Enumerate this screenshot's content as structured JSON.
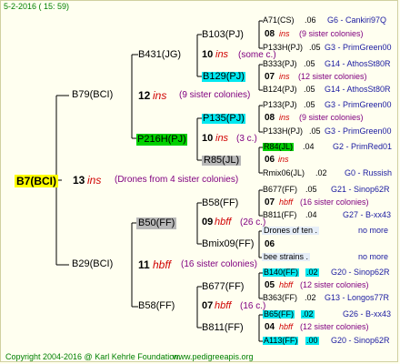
{
  "header": {
    "date": "5-2-2016 ( 15: 59)"
  },
  "footer": {
    "copyright": "Copyright 2004-2016 @ Karl Kehrle Foundation.",
    "site": "www.pedigreeapis.org"
  },
  "root": {
    "id": "B7(BCI)",
    "num": "13",
    "ins": "ins",
    "note": "(Drones from 4 sister colonies)"
  },
  "g1": [
    {
      "id": "B79(BCI)",
      "num": "12",
      "ins": "ins",
      "note": "(9 sister colonies)"
    },
    {
      "id": "B29(BCI)",
      "num": "11",
      "ins": "hbff",
      "note": "(16 sister colonies)"
    }
  ],
  "g2": [
    {
      "id": "B431(JG)",
      "num": "10",
      "ins": "ins",
      "note": "(some c.)"
    },
    {
      "id": "P216H(PJ)",
      "num": "10",
      "ins": "ins",
      "note": "(3 c.)"
    },
    {
      "id": "B50(FF)",
      "num": "09",
      "ins": "hbff",
      "note": "(26 c.)"
    },
    {
      "id": "B58(FF)",
      "num": "07",
      "ins": "hbff",
      "note": "(16 c.)"
    }
  ],
  "g3": [
    "B103(PJ)",
    "B129(PJ)",
    "P135(PJ)",
    "R85(JL)",
    "B58(FF)",
    "Bmix09(FF)",
    "B677(FF)",
    "B811(FF)"
  ],
  "g4": [
    {
      "id": "A71(CS)",
      "num": ".06",
      "ref": "G6 - Cankiri97Q"
    },
    {
      "num": "08",
      "ins": "ins",
      "note": "(9 sister colonies)"
    },
    {
      "id": "P133H(PJ)",
      "num": ".05",
      "ref": "G3 - PrimGreen00"
    },
    {
      "id": "B333(PJ)",
      "num": ".05",
      "ref": "G14 - AthosSt80R"
    },
    {
      "num": "07",
      "ins": "ins",
      "note": "(12 sister colonies)"
    },
    {
      "id": "B124(PJ)",
      "num": ".05",
      "ref": "G14 - AthosSt80R"
    },
    {
      "id": "P133(PJ)",
      "num": ".05",
      "ref": "G3 - PrimGreen00"
    },
    {
      "num": "08",
      "ins": "ins",
      "note": "(9 sister colonies)"
    },
    {
      "id": "P133H(PJ)",
      "num": ".05",
      "ref": "G3 - PrimGreen00"
    },
    {
      "id": "R84(JL)",
      "num": ".04",
      "ref": "G2 - PrimRed01"
    },
    {
      "num": "06",
      "ins": "ins"
    },
    {
      "id": "Rmix06(JL)",
      "num": ".02",
      "ref": "G0 - Russish"
    },
    {
      "id": "B677(FF)",
      "num": ".05",
      "ref": "G21 - Sinop62R"
    },
    {
      "num": "07",
      "ins": "hbff",
      "note": "(16 sister colonies)"
    },
    {
      "id": "B811(FF)",
      "num": ".04",
      "ref": "G27 - B-xx43"
    },
    {
      "text": "Drones of ten .",
      "ref": "no more"
    },
    {
      "num": "06"
    },
    {
      "text": "bee strains .",
      "ref": "no more"
    },
    {
      "id": "B140(FF)",
      "num": ".02",
      "ref": "G20 - Sinop62R"
    },
    {
      "num": "05",
      "ins": "hbff",
      "note": "(12 sister colonies)"
    },
    {
      "id": "B363(FF)",
      "num": ".02",
      "ref": "G13 - Longos77R"
    },
    {
      "id": "B65(FF)",
      "num": ".02",
      "ref": "G26 - B-xx43"
    },
    {
      "num": "04",
      "ins": "hbff",
      "note": "(12 sister colonies)"
    },
    {
      "id": "A113(FF)",
      "num": ".00",
      "ref": "G20 - Sinop62R"
    }
  ]
}
